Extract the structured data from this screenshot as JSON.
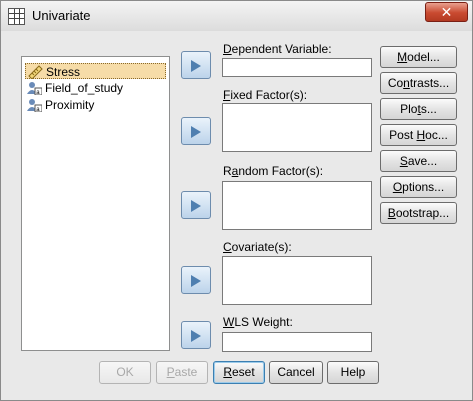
{
  "window": {
    "title": "Univariate",
    "close_label": "✕"
  },
  "variables": [
    {
      "name": "Stress",
      "type": "scale",
      "selected": true
    },
    {
      "name": "Field_of_study",
      "type": "nominal",
      "selected": false
    },
    {
      "name": "Proximity",
      "type": "nominal",
      "selected": false
    }
  ],
  "fields": {
    "dependent": {
      "label": "Dependent Variable:",
      "mnemonic": "D",
      "rest": "ependent Variable:"
    },
    "fixed": {
      "label": "Fixed Factor(s):",
      "mnemonic": "F",
      "rest": "ixed Factor(s):"
    },
    "random": {
      "label": "Random Factor(s):",
      "pre": "R",
      "mnemonic": "a",
      "rest": "ndom Factor(s):"
    },
    "covariate": {
      "label": "Covariate(s):",
      "mnemonic": "C",
      "rest": "ovariate(s):"
    },
    "wls": {
      "label": "WLS Weight:",
      "mnemonic": "W",
      "rest": "LS Weight:"
    }
  },
  "side_buttons": [
    {
      "label": "Model...",
      "mnemonic": "M",
      "rest": "odel..."
    },
    {
      "label": "Contrasts...",
      "pre": "Co",
      "mnemonic": "n",
      "rest": "trasts..."
    },
    {
      "label": "Plots...",
      "pre": "Plo",
      "mnemonic": "t",
      "rest": "s..."
    },
    {
      "label": "Post Hoc...",
      "pre": "Post ",
      "mnemonic": "H",
      "rest": "oc..."
    },
    {
      "label": "Save...",
      "mnemonic": "S",
      "rest": "ave..."
    },
    {
      "label": "Options...",
      "mnemonic": "O",
      "rest": "ptions..."
    },
    {
      "label": "Bootstrap...",
      "mnemonic": "B",
      "rest": "ootstrap..."
    }
  ],
  "bottom_buttons": {
    "ok": {
      "label": "OK",
      "enabled": false
    },
    "paste": {
      "label": "Paste",
      "mnemonic": "P",
      "rest": "aste",
      "enabled": false
    },
    "reset": {
      "label": "Reset",
      "mnemonic": "R",
      "rest": "eset",
      "enabled": true
    },
    "cancel": {
      "label": "Cancel",
      "enabled": true
    },
    "help": {
      "label": "Help",
      "enabled": true
    }
  }
}
